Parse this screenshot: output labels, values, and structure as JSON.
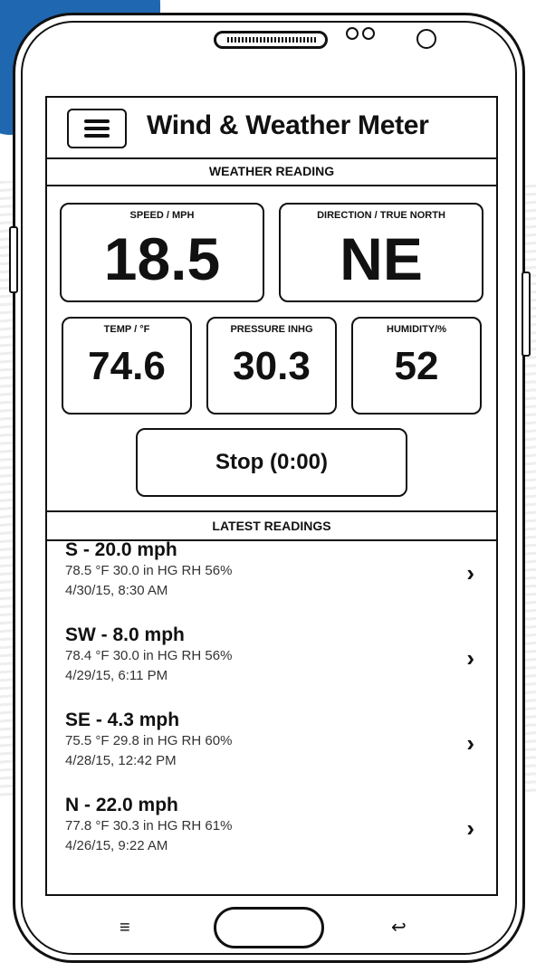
{
  "app": {
    "title": "Wind & Weather Meter"
  },
  "weather": {
    "section_title": "WEATHER READING",
    "speed": {
      "label": "SPEED / MPH",
      "value": "18.5"
    },
    "direction": {
      "label": "DIRECTION / TRUE NORTH",
      "value": "NE"
    },
    "temp": {
      "label": "TEMP / °F",
      "value": "74.6"
    },
    "pressure": {
      "label": "PRESSURE INHG",
      "value": "30.3"
    },
    "humidity": {
      "label": "HUMIDITY/%",
      "value": "52"
    },
    "stop_button": "Stop (0:00)"
  },
  "latest": {
    "section_title": "LATEST READINGS",
    "items": [
      {
        "title": "S - 20.0 mph",
        "details": "78.5 °F   30.0 in HG   RH 56%",
        "date": "4/30/15, 8:30 AM"
      },
      {
        "title": "SW - 8.0 mph",
        "details": "78.4 °F   30.0 in HG   RH 56%",
        "date": "4/29/15, 6:11 PM"
      },
      {
        "title": "SE - 4.3 mph",
        "details": "75.5 °F   29.8  in HG   RH 60%",
        "date": "4/28/15, 12:42 PM"
      },
      {
        "title": "N - 22.0 mph",
        "details": "77.8 °F   30.3 in HG   RH 61%",
        "date": "4/26/15, 9:22 AM"
      }
    ]
  },
  "icons": {
    "menu": "hamburger-icon",
    "chevron": "›",
    "nav_menu": "≡",
    "nav_back": "↩"
  },
  "colors": {
    "accent": "#1f67b0",
    "ink": "#111111"
  }
}
